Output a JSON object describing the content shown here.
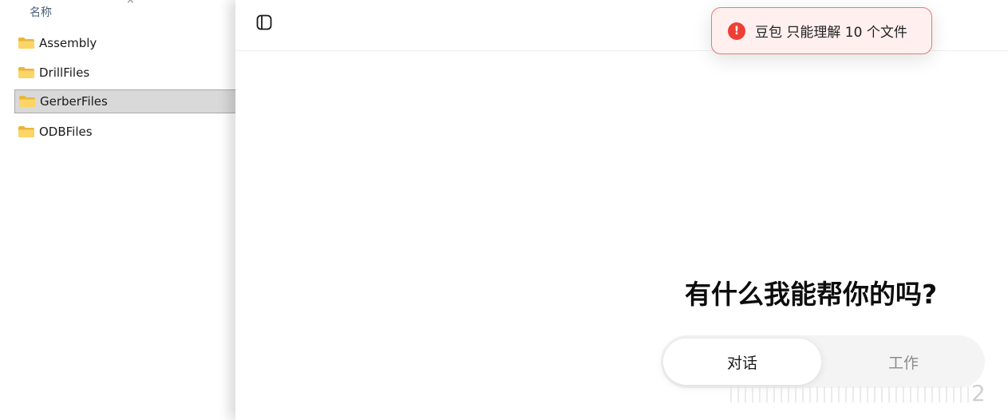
{
  "explorer": {
    "column_header": "名称",
    "close_glyph": "×",
    "items": [
      {
        "label": "Assembly"
      },
      {
        "label": "DrillFiles"
      },
      {
        "label": "GerberFiles",
        "selected": true
      },
      {
        "label": "ODBFiles"
      }
    ],
    "folder_icon": "folder-icon"
  },
  "chat": {
    "sidebar_toggle_icon": "sidebar-toggle-icon",
    "toast": {
      "icon": "!",
      "message": "豆包 只能理解 10 个文件",
      "color": "#ee3f37"
    },
    "headline": "有什么我能帮你的吗?",
    "modes": [
      {
        "label": "对话",
        "active": true
      },
      {
        "label": "工作",
        "active": false
      }
    ],
    "corner_text": "2"
  }
}
